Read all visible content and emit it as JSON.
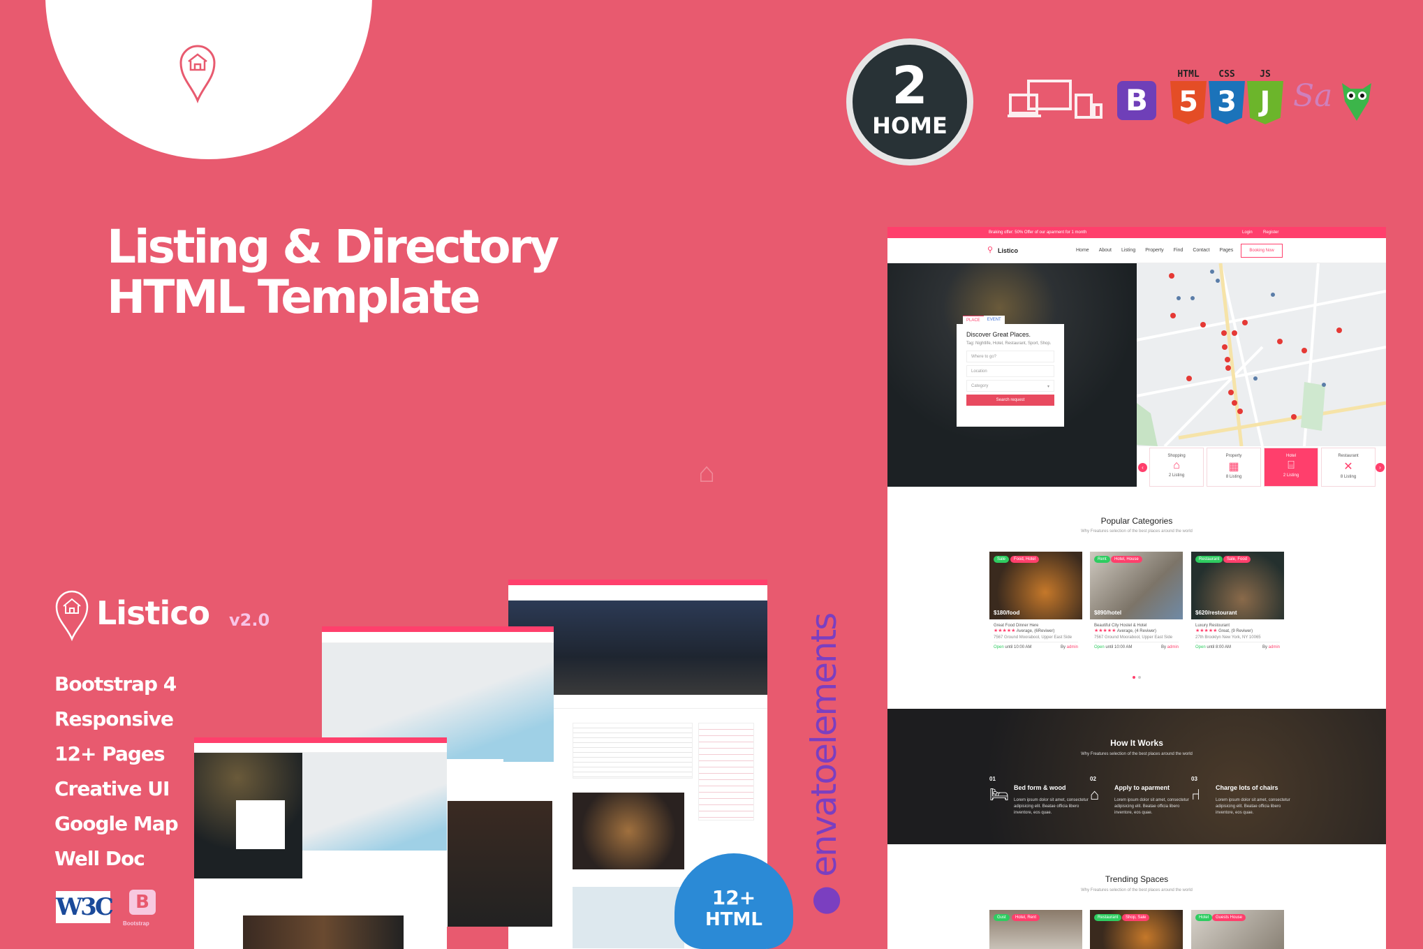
{
  "promo": {
    "title_line1": "Listing & Directory",
    "title_line2": "HTML Template",
    "home_count": "2",
    "home_label": "HOME",
    "tech_labels": [
      "HTML",
      "CSS",
      "JS"
    ],
    "tech_icons": [
      "devices-icon",
      "bootstrap-icon",
      "html5-icon",
      "css3-icon",
      "js-icon",
      "sass-icon",
      "owl-icon"
    ],
    "brand": "Listico",
    "version": "v2.0",
    "features": [
      "Bootstrap 4",
      "Responsive",
      "12+ Pages",
      "Creative UI",
      "Google Map",
      "Well Doc"
    ],
    "w3c": "W3C",
    "bootstrap_badge": "Bootstrap",
    "html_badge_count": "12+",
    "html_badge_label": "HTML",
    "envato": "envatoelements",
    "colors": {
      "background": "#e85a6f",
      "accent": "#ff3f6c",
      "dark": "#283236"
    }
  },
  "mock": {
    "topbar_offer": "Braking offer: 50% Offer of our aparment for 1 month",
    "login": "Login",
    "register": "Register",
    "logo": "Listico",
    "nav": [
      "Home",
      "About",
      "Listing",
      "Property",
      "Find",
      "Contact",
      "Pages"
    ],
    "booking": "Booking Now",
    "search": {
      "tabs": [
        "PLACE",
        "EVENT"
      ],
      "heading": "Discover Great Places.",
      "tags": "Tag: Nightlife, Hotel, Restaurant, Sport, Shop.",
      "where": "Where to go?",
      "location": "Location",
      "category": "Category",
      "button": "Search request"
    },
    "categories": [
      {
        "name": "Shopping",
        "count": "2 Listing"
      },
      {
        "name": "Property",
        "count": "8 Listing"
      },
      {
        "name": "Hotel",
        "count": "2 Listing"
      },
      {
        "name": "Restaurant",
        "count": "8 Listing"
      }
    ],
    "popular": {
      "title": "Popular Categories",
      "subtitle": "Why Freatures selection of the best places around the world",
      "cards": [
        {
          "tag1": "Sale",
          "tag2": "Food, Hotel",
          "price": "$180/food",
          "name": "Great Food Dinner Here",
          "rating": "Average, (6Reviwer)",
          "address": "7567 Ground Moorabool, Upper East Side",
          "open": "Open",
          "until": "until 10:00 AM",
          "by": "By",
          "author": "admin"
        },
        {
          "tag1": "Rent",
          "tag2": "Hotel, House",
          "price": "$890/hotel",
          "name": "Beautiful City Hostel & Hotel",
          "rating": "Average, (4 Reviwer)",
          "address": "7567 Ground Moorabool, Upper East Side",
          "open": "Open",
          "until": "until 10:00 AM",
          "by": "By",
          "author": "admin"
        },
        {
          "tag1": "Restaurant",
          "tag2": "Sale, Food",
          "price": "$620/restourant",
          "name": "Luxury Restourant",
          "rating": "Great, (9 Reviwer)",
          "address": "27th Brooklyn New York, NY 10065",
          "open": "Open",
          "until": "until 8:00 AM",
          "by": "By",
          "author": "admin"
        }
      ]
    },
    "how": {
      "title": "How It Works",
      "subtitle": "Why Freatures selection of the best places around the world",
      "steps": [
        {
          "no": "01",
          "title": "Bed form & wood",
          "text": "Lorem ipsum dolor sit amet, consectetur adipisicing elit. Beatae officia libero inventore, eos quae."
        },
        {
          "no": "02",
          "title": "Apply to aparment",
          "text": "Lorem ipsum dolor sit amet, consectetur adipisicing elit. Beatae officia libero inventore, eos quae."
        },
        {
          "no": "03",
          "title": "Charge lots of chairs",
          "text": "Lorem ipsum dolor sit amet, consectetur adipisicing elit. Beatae officia libero inventore, eos quae."
        }
      ]
    },
    "trending": {
      "title": "Trending Spaces",
      "subtitle": "Why Freatures selection of the best places around the world",
      "cards": [
        {
          "tag1": "Gust",
          "tag2": "Hotel, Rent"
        },
        {
          "tag1": "Restaurant",
          "tag2": "Shop, Sale"
        },
        {
          "tag1": "Hotel",
          "tag2": "Guests House"
        }
      ]
    }
  }
}
